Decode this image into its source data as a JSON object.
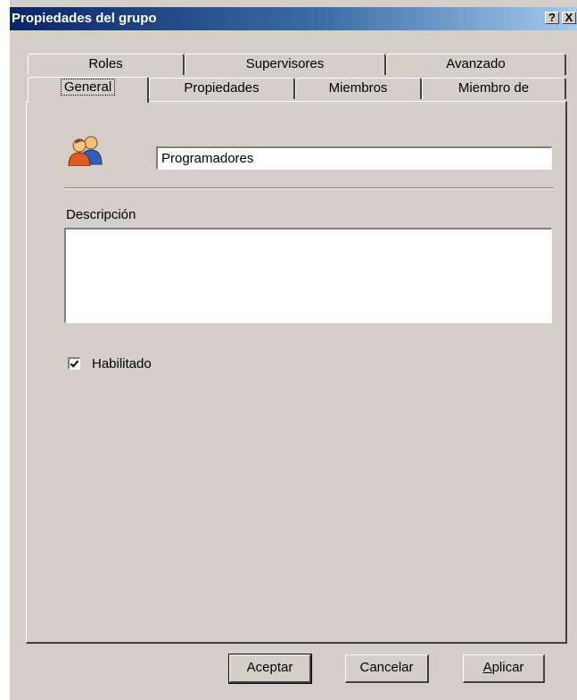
{
  "window": {
    "title": "Propiedades del grupo",
    "help_label": "?",
    "close_label": "X"
  },
  "tabs": {
    "row1": [
      "Roles",
      "Supervisores",
      "Avanzado"
    ],
    "row2": [
      "General",
      "Propiedades",
      "Miembros",
      "Miembro de"
    ],
    "active": "General"
  },
  "general": {
    "group_name": "Programadores",
    "group_icon": "users-group-icon",
    "description_label": "Descripción",
    "description_value": "",
    "enabled_label": "Habilitado",
    "enabled": true
  },
  "buttons": {
    "ok": "Aceptar",
    "cancel": "Cancelar",
    "apply_prefix": "A",
    "apply_rest": "plicar"
  },
  "colors": {
    "title_start": "#0a246a",
    "title_end": "#a6caf0",
    "dialog_face": "#d4d0c8"
  }
}
